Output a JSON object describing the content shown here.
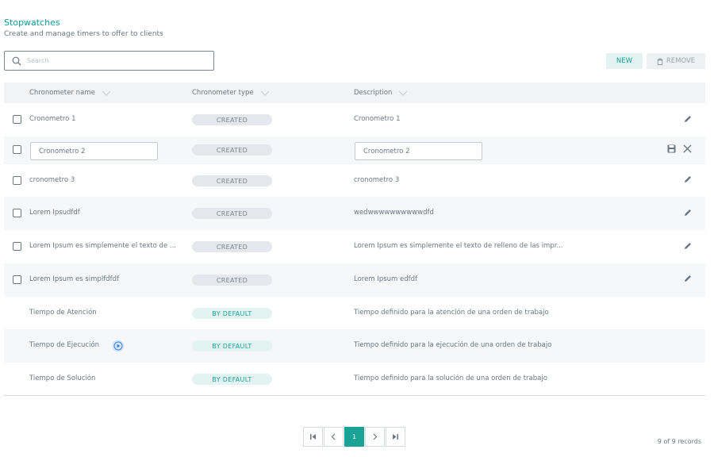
{
  "header": {
    "title": "Stopwatches",
    "subtitle": "Create and manage timers to offer to clients"
  },
  "search": {
    "placeholder": "Search",
    "value": ""
  },
  "toolbar": {
    "new_label": "NEW",
    "remove_label": "REMOVE"
  },
  "table": {
    "columns": [
      "Chronometer name",
      "Chronometer type",
      "Description"
    ],
    "rows": [
      {
        "name": "Cronometro 1",
        "type": "CREATED",
        "description": "Cronometro 1",
        "selectable": true,
        "editing": false
      },
      {
        "name": "Cronometro 2",
        "type": "CREATED",
        "description": "Cronometro 2",
        "selectable": true,
        "editing": true
      },
      {
        "name": "cronometro 3",
        "type": "CREATED",
        "description": "cronometro 3",
        "selectable": true,
        "editing": false
      },
      {
        "name": "Lorem Ipsudfdf",
        "type": "CREATED",
        "description": "wedwwwwwwwwwwdfd",
        "selectable": true,
        "editing": false
      },
      {
        "name": "Lorem Ipsum es simplemente el texto de ...",
        "type": "CREATED",
        "description": "Lorem Ipsum es simplemente el texto de relleno de las impr...",
        "selectable": true,
        "editing": false
      },
      {
        "name": "Lorem Ipsum es simplfdfdf",
        "type": "CREATED",
        "description": "Lorem Ipsum edfdf",
        "selectable": true,
        "editing": false
      },
      {
        "name": "Tiempo de Atención",
        "type": "BY DEFAULT",
        "description": "Tiempo definido para la atención de una orden de trabajo",
        "selectable": false,
        "editing": false
      },
      {
        "name": "Tiempo de Ejecución",
        "type": "BY DEFAULT",
        "description": "Tiempo definido para la ejecución de una orden de trabajo",
        "selectable": false,
        "editing": false
      },
      {
        "name": "Tiempo de Solución",
        "type": "BY DEFAULT",
        "description": "Tiempo definido para la solución de una orden de trabajo",
        "selectable": false,
        "editing": false
      }
    ]
  },
  "pagination": {
    "current_page": "1",
    "records_label": "9 of 9 records"
  },
  "colors": {
    "accent": "#1aa296",
    "title": "#139d94",
    "badge_default_bg": "#e3f3f2",
    "badge_created_bg": "#e4e7eb"
  },
  "icons": {
    "search": "search-icon",
    "remove": "trash-icon",
    "edit": "pencil-icon",
    "save": "save-icon",
    "cancel": "close-icon",
    "play": "play-circle-icon"
  }
}
